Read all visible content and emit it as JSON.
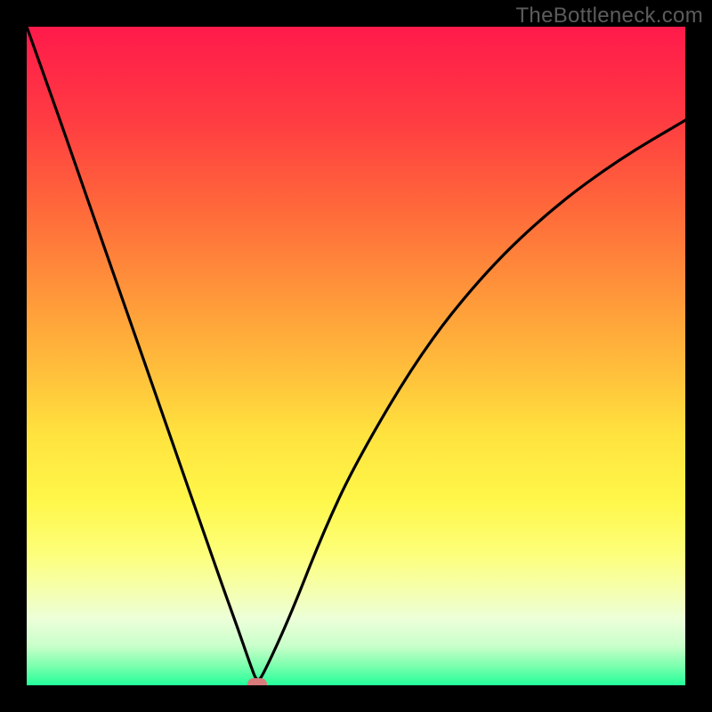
{
  "watermark": "TheBottleneck.com",
  "chart_data": {
    "type": "line",
    "title": "",
    "xlabel": "",
    "ylabel": "",
    "xlim": [
      0,
      1
    ],
    "ylim": [
      0,
      1
    ],
    "grid": false,
    "legend": false,
    "background": {
      "gradient_top_color": "#ff1a4b",
      "gradient_bottom_color": "#23ff9a"
    },
    "series": [
      {
        "name": "curve",
        "color": "#000000",
        "x": [
          0.0,
          0.05,
          0.1,
          0.15,
          0.2,
          0.25,
          0.3,
          0.32,
          0.34,
          0.35,
          0.36,
          0.4,
          0.45,
          0.5,
          0.6,
          0.7,
          0.8,
          0.9,
          1.0
        ],
        "y": [
          1.0,
          0.86,
          0.716,
          0.573,
          0.43,
          0.286,
          0.143,
          0.088,
          0.03,
          0.004,
          0.018,
          0.105,
          0.232,
          0.339,
          0.508,
          0.632,
          0.726,
          0.799,
          0.858
        ]
      }
    ],
    "markers": [
      {
        "name": "min-marker",
        "x": 0.35,
        "y": 0.002,
        "color": "#d97a7b"
      }
    ]
  }
}
